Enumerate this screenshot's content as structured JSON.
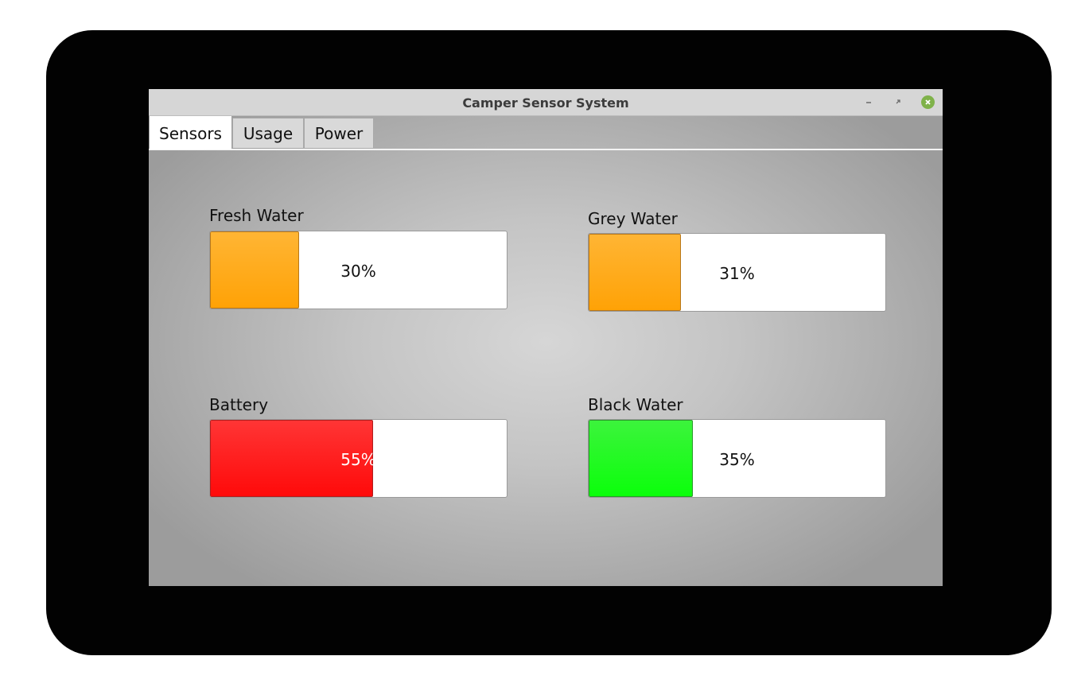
{
  "window": {
    "title": "Camper Sensor System",
    "controls": {
      "minimize_icon": "minimize-icon",
      "restore_icon": "restore-icon",
      "close_icon": "close-icon"
    }
  },
  "tabs": [
    {
      "label": "Sensors",
      "active": true
    },
    {
      "label": "Usage",
      "active": false
    },
    {
      "label": "Power",
      "active": false
    }
  ],
  "sensors": {
    "fresh_water": {
      "label": "Fresh Water",
      "value": 30,
      "display": "30%",
      "color": "#ffa206"
    },
    "grey_water": {
      "label": "Grey Water",
      "value": 31,
      "display": "31%",
      "color": "#ffa206"
    },
    "battery": {
      "label": "Battery",
      "value": 55,
      "display": "55%",
      "color": "#ff0a0a"
    },
    "black_water": {
      "label": "Black Water",
      "value": 35,
      "display": "35%",
      "color": "#0bff0b"
    }
  }
}
